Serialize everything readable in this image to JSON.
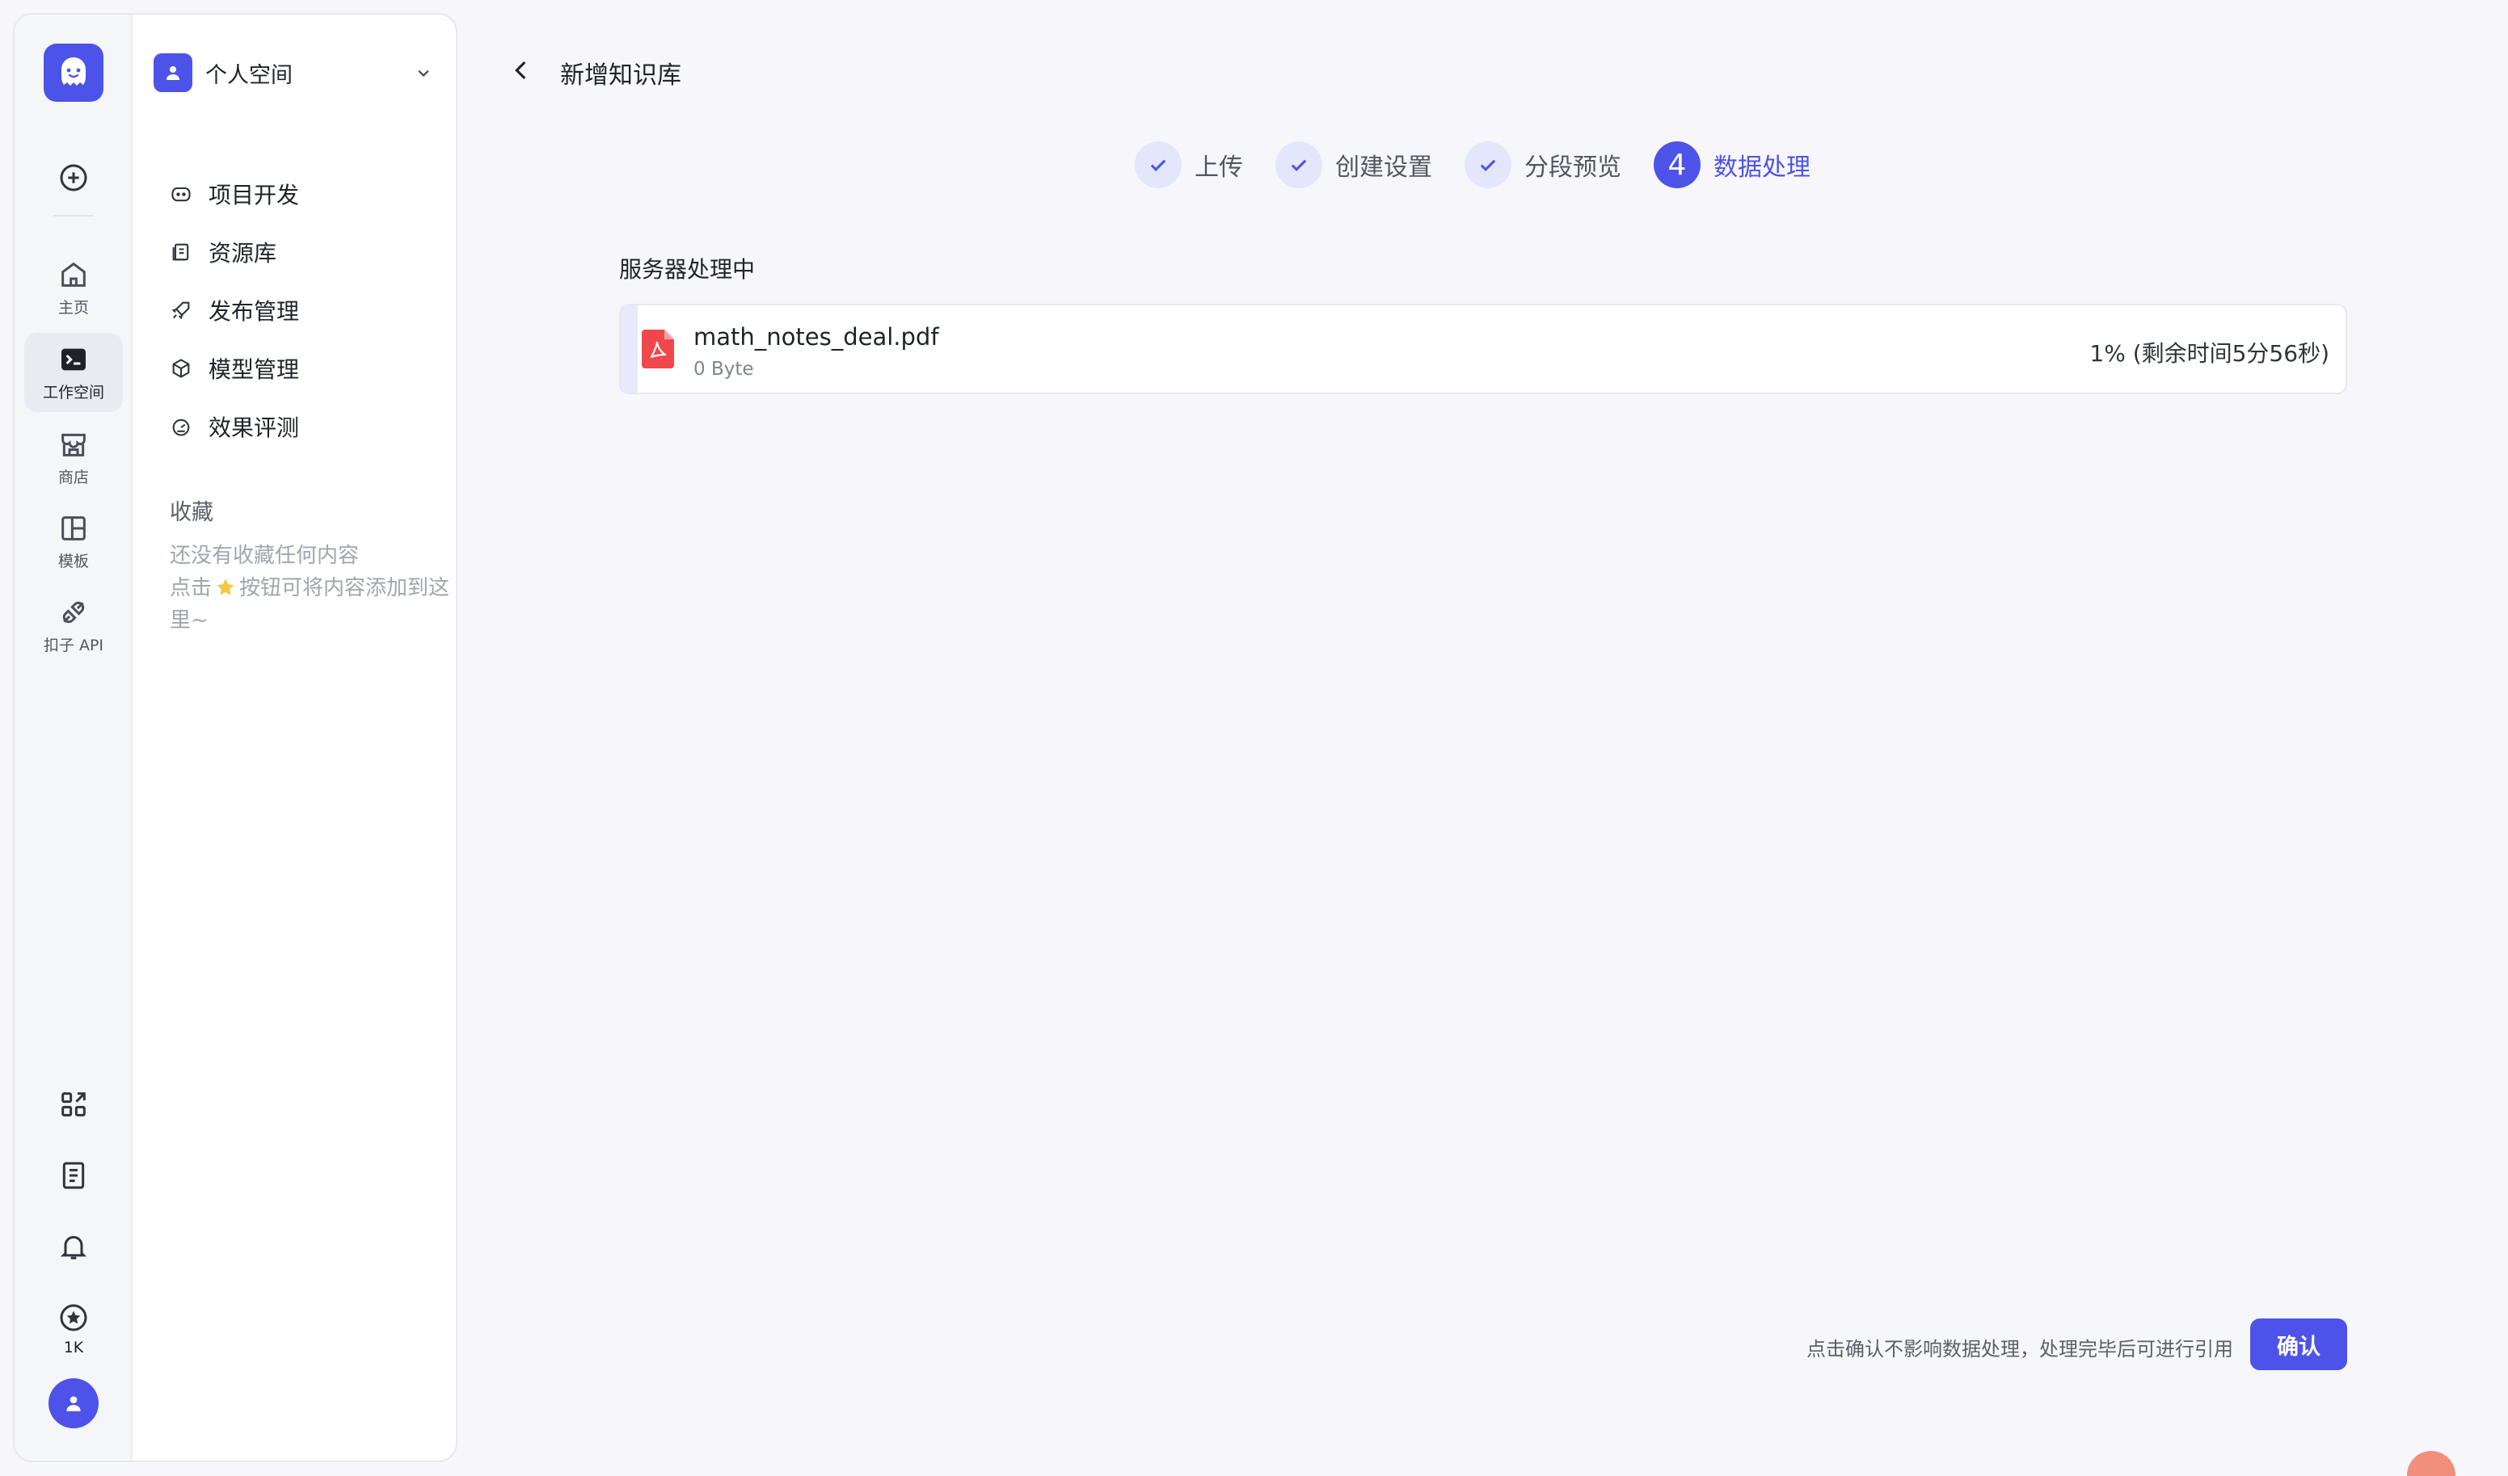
{
  "rail": {
    "items": [
      {
        "label": "主页"
      },
      {
        "label": "工作空间"
      },
      {
        "label": "商店"
      },
      {
        "label": "模板"
      },
      {
        "label": "扣子 API"
      }
    ],
    "credits": "1K"
  },
  "sidebar": {
    "space_name": "个人空间",
    "nav": [
      {
        "label": "项目开发",
        "icon": "robot-icon"
      },
      {
        "label": "资源库",
        "icon": "library-icon"
      },
      {
        "label": "发布管理",
        "icon": "rocket-icon"
      },
      {
        "label": "模型管理",
        "icon": "cube-icon"
      },
      {
        "label": "效果评测",
        "icon": "gauge-icon"
      }
    ],
    "favorites_title": "收藏",
    "favorites_empty_line1": "还没有收藏任何内容",
    "favorites_empty_line2_prefix": "点击",
    "favorites_empty_line2_suffix": "按钮可将内容添加到这里~"
  },
  "main": {
    "title": "新增知识库",
    "steps": [
      {
        "label": "上传",
        "state": "done"
      },
      {
        "label": "创建设置",
        "state": "done"
      },
      {
        "label": "分段预览",
        "state": "done"
      },
      {
        "label": "数据处理",
        "state": "current",
        "number": "4"
      }
    ],
    "section_title": "服务器处理中",
    "file": {
      "name": "math_notes_deal.pdf",
      "size": "0 Byte",
      "progress_text": "1% (剩余时间5分56秒)",
      "progress_percent": 1
    },
    "hint": "点击确认不影响数据处理，处理完毕后可进行引用",
    "confirm_label": "确认"
  },
  "colors": {
    "accent": "#4d53e8",
    "pdf_red": "#f0484a"
  }
}
